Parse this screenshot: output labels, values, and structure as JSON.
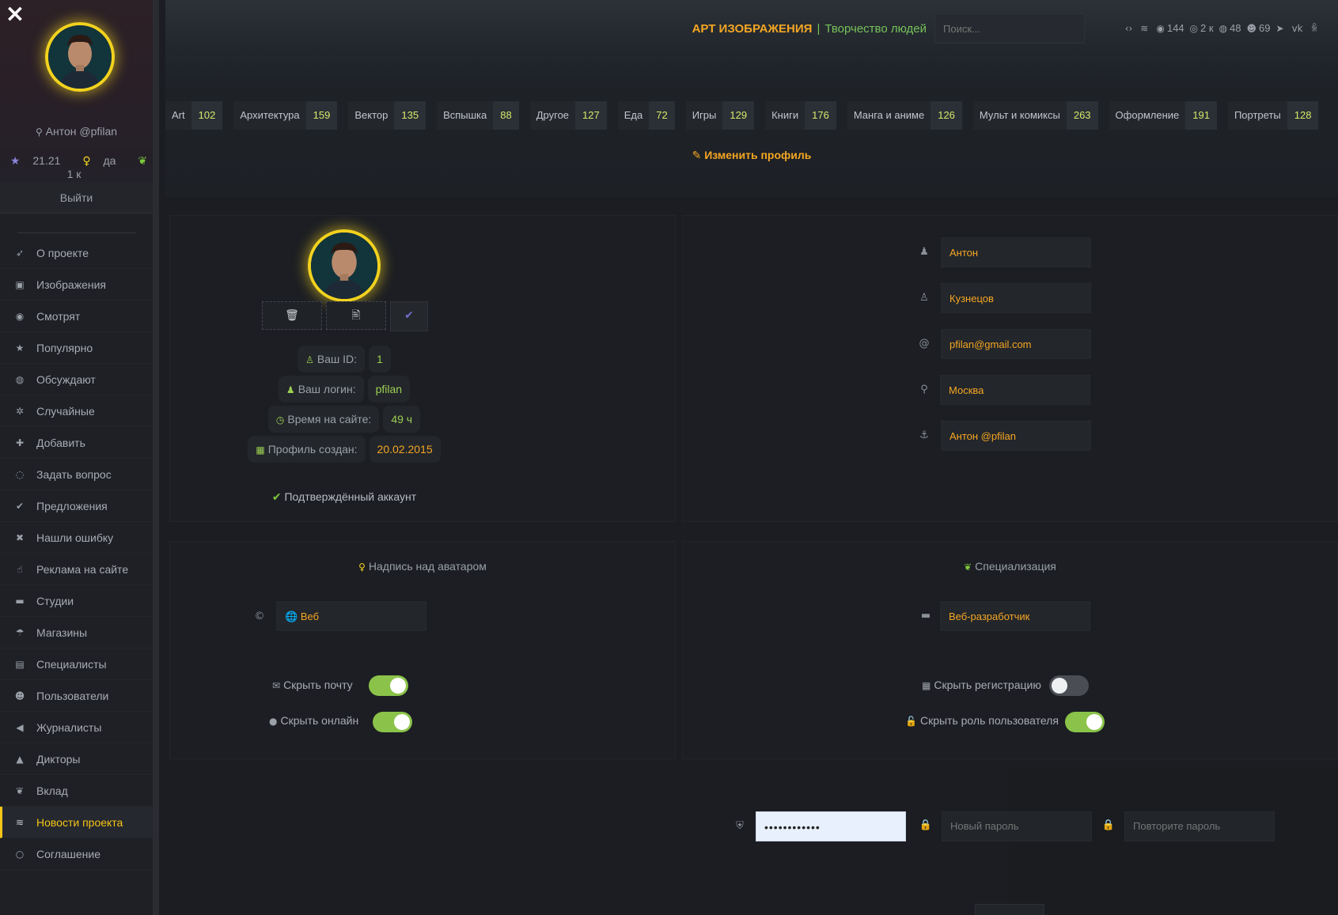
{
  "sidebar": {
    "close_icon": "×",
    "user": "Антон @pfilan",
    "stats": {
      "rating": "21.21",
      "bulb": "да",
      "leaf": "1 к"
    },
    "logout": "Выйти",
    "items": [
      {
        "icon": "rocket-icon",
        "glyph": "➶",
        "label": "О проекте"
      },
      {
        "icon": "image-icon",
        "glyph": "▣",
        "label": "Изображения"
      },
      {
        "icon": "eye-icon",
        "glyph": "◉",
        "label": "Смотрят"
      },
      {
        "icon": "star-icon",
        "glyph": "★",
        "label": "Популярно"
      },
      {
        "icon": "comments-icon",
        "glyph": "◍",
        "label": "Обсуждают"
      },
      {
        "icon": "random-icon",
        "glyph": "✲",
        "label": "Случайные"
      },
      {
        "icon": "plus-icon",
        "glyph": "✚",
        "label": "Добавить"
      },
      {
        "icon": "comment-icon",
        "glyph": "◌",
        "label": "Задать вопрос"
      },
      {
        "icon": "check-icon",
        "glyph": "✔",
        "label": "Предложения"
      },
      {
        "icon": "cross-icon",
        "glyph": "✖",
        "label": "Нашли ошибку"
      },
      {
        "icon": "hand-icon",
        "glyph": "☝",
        "label": "Реклама на сайте"
      },
      {
        "icon": "briefcase-icon",
        "glyph": "▬",
        "label": "Студии"
      },
      {
        "icon": "umbrella-icon",
        "glyph": "☂",
        "label": "Магазины"
      },
      {
        "icon": "id-card-icon",
        "glyph": "▤",
        "label": "Специалисты"
      },
      {
        "icon": "users-icon",
        "glyph": "☻",
        "label": "Пользователи"
      },
      {
        "icon": "bullhorn-icon",
        "glyph": "◀",
        "label": "Журналисты"
      },
      {
        "icon": "graduation-cap-icon",
        "glyph": "▲",
        "label": "Дикторы"
      },
      {
        "icon": "leaf-icon",
        "glyph": "❦",
        "label": "Вклад"
      },
      {
        "icon": "rss-icon",
        "glyph": "≋",
        "label": "Новости проекта",
        "active": true
      },
      {
        "icon": "circle-icon",
        "glyph": "○",
        "label": "Соглашение"
      }
    ]
  },
  "header": {
    "brand_main": "АРТ ИЗОБРАЖЕНИЯ",
    "brand_sep": "|",
    "brand_sub": "Творчество людей",
    "search_placeholder": "Поиск...",
    "stats": [
      {
        "icon": "code-icon",
        "glyph": "‹›",
        "value": ""
      },
      {
        "icon": "rss-icon",
        "glyph": "≋",
        "value": ""
      },
      {
        "icon": "eye-icon",
        "glyph": "◉",
        "value": "144"
      },
      {
        "icon": "target-icon",
        "glyph": "◎",
        "value": "2 к"
      },
      {
        "icon": "comments-icon",
        "glyph": "◍",
        "value": "48"
      },
      {
        "icon": "users-icon",
        "glyph": "☻",
        "value": "69"
      },
      {
        "icon": "telegram-icon",
        "glyph": "➤",
        "value": ""
      },
      {
        "icon": "vk-icon",
        "glyph": "vk",
        "value": ""
      },
      {
        "icon": "odnoklassniki-icon",
        "glyph": "ꆜ",
        "value": ""
      }
    ],
    "categories": [
      {
        "name": "Art",
        "count": "102"
      },
      {
        "name": "Архитектура",
        "count": "159"
      },
      {
        "name": "Вектор",
        "count": "135"
      },
      {
        "name": "Вспышка",
        "count": "88"
      },
      {
        "name": "Другое",
        "count": "127"
      },
      {
        "name": "Еда",
        "count": "72"
      },
      {
        "name": "Игры",
        "count": "129"
      },
      {
        "name": "Книги",
        "count": "176"
      },
      {
        "name": "Манга и аниме",
        "count": "126"
      },
      {
        "name": "Мульт и комиксы",
        "count": "263"
      },
      {
        "name": "Оформление",
        "count": "191"
      },
      {
        "name": "Портреты",
        "count": "128"
      }
    ],
    "edit_profile": "Изменить профиль"
  },
  "profile": {
    "avatar_buttons": {
      "delete": "🗑",
      "upload": "🖹",
      "save": "✔"
    },
    "info": [
      {
        "icon": "user-icon",
        "glyph": "♙",
        "label": "Ваш ID:",
        "value": "1",
        "color": "green"
      },
      {
        "icon": "user-solid-icon",
        "glyph": "♟",
        "label": "Ваш логин:",
        "value": "pfilan",
        "color": "green"
      },
      {
        "icon": "clock-icon",
        "glyph": "◷",
        "label": "Время на сайте:",
        "value": "49 ч",
        "color": "green"
      },
      {
        "icon": "calendar-icon",
        "glyph": "▦",
        "label": "Профиль создан:",
        "value": "20.02.2015",
        "color": "orange"
      }
    ],
    "verified": "Подтверждённый аккаунт"
  },
  "fields": {
    "first_name": "Антон",
    "last_name": "Кузнецов",
    "email": "pfilan@gmail.com",
    "city": "Москва",
    "display_name": "Антон @pfilan"
  },
  "caption": {
    "title": "Надпись над аватаром",
    "value": "Веб",
    "hide_email": "Скрыть почту",
    "hide_online": "Скрыть онлайн",
    "hide_email_on": true,
    "hide_online_on": true
  },
  "spec": {
    "title": "Специализация",
    "value": "Веб-разработчик",
    "hide_registration": "Скрыть регистрацию",
    "hide_role": "Скрыть роль пользователя",
    "hide_registration_on": false,
    "hide_role_on": true
  },
  "password": {
    "current": "••••••••••••",
    "new_placeholder": "Новый пароль",
    "repeat_placeholder": "Повторите пароль"
  },
  "colors": {
    "accent": "#f5a623",
    "green": "#8bc34a",
    "gold": "#f2d21f"
  }
}
